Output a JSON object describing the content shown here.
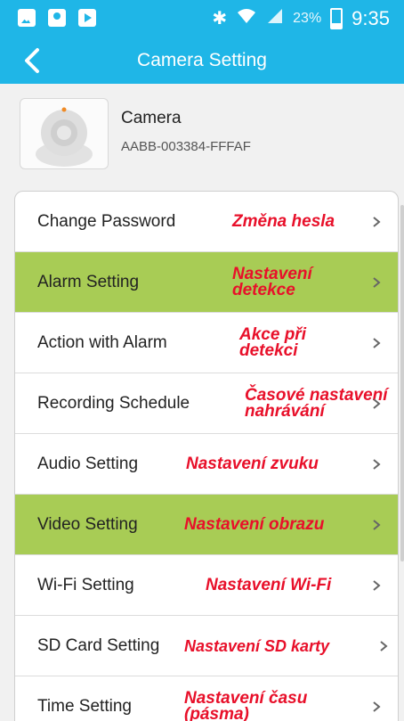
{
  "status_bar": {
    "battery_percent": "23%",
    "time": "9:35",
    "icons": [
      "gallery-icon",
      "location-pin-icon",
      "media-play-icon",
      "bluetooth-icon",
      "wifi-icon",
      "signal-icon",
      "battery-icon"
    ]
  },
  "nav": {
    "title": "Camera Setting",
    "back_icon": "chevron-left-icon"
  },
  "camera": {
    "name": "Camera",
    "id": "AABB-003384-FFFAF"
  },
  "settings": {
    "rows": [
      {
        "label": "Change Password",
        "note": "Změna hesla",
        "highlighted": false
      },
      {
        "label": "Alarm Setting",
        "note": "Nastavení\ndetekce",
        "highlighted": true
      },
      {
        "label": "Action with Alarm",
        "note": "Akce při\ndetekci",
        "highlighted": false
      },
      {
        "label": "Recording Schedule",
        "note": "Časové nastavení\nnahrávání",
        "highlighted": false
      },
      {
        "label": "Audio Setting",
        "note": "Nastavení zvuku",
        "highlighted": false
      },
      {
        "label": "Video Setting",
        "note": "Nastavení obrazu",
        "highlighted": true
      },
      {
        "label": "Wi-Fi Setting",
        "note": "Nastavení Wi-Fi",
        "highlighted": false
      },
      {
        "label": "SD Card Setting",
        "note": "Nastavení SD karty",
        "highlighted": false
      },
      {
        "label": "Time Setting",
        "note": "Nastavení času\n(pásma)",
        "highlighted": false
      }
    ]
  },
  "colors": {
    "header_blue": "#1fb6e7",
    "highlight_green": "#a8cc55",
    "annotation_red": "#e8102a"
  }
}
